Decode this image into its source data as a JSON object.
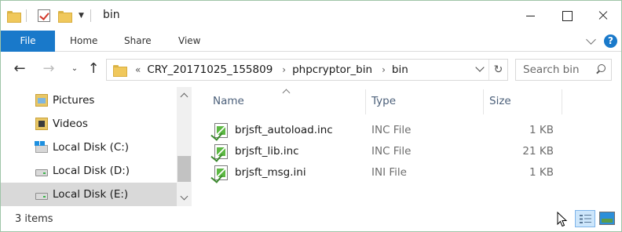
{
  "window": {
    "title": "bin",
    "accent_color": "#1979ca",
    "controls": [
      "minimize",
      "maximize",
      "close"
    ]
  },
  "ribbon": {
    "tabs": [
      {
        "label": "File",
        "active": true
      },
      {
        "label": "Home"
      },
      {
        "label": "Share"
      },
      {
        "label": "View"
      }
    ],
    "help_label": "?"
  },
  "address": {
    "overflow": "«",
    "breadcrumbs": [
      "CRY_20171025_155809",
      "phpcryptor_bin",
      "bin"
    ],
    "separator": "›"
  },
  "search": {
    "placeholder": "Search bin"
  },
  "nav_pane": {
    "items": [
      {
        "label": "Pictures",
        "icon": "pictures-folder-icon"
      },
      {
        "label": "Videos",
        "icon": "videos-folder-icon"
      },
      {
        "label": "Local Disk (C:)",
        "icon": "windows-drive-icon"
      },
      {
        "label": "Local Disk (D:)",
        "icon": "drive-icon"
      },
      {
        "label": "Local Disk (E:)",
        "icon": "drive-icon",
        "selected": true
      }
    ]
  },
  "file_list": {
    "columns": [
      "Name",
      "Type",
      "Size"
    ],
    "sort_column": "Name",
    "rows": [
      {
        "name": "brjsft_autoload.inc",
        "type": "INC File",
        "size": "1 KB"
      },
      {
        "name": "brjsft_lib.inc",
        "type": "INC File",
        "size": "21 KB"
      },
      {
        "name": "brjsft_msg.ini",
        "type": "INI File",
        "size": "1 KB"
      }
    ]
  },
  "status": {
    "item_count": "3 items",
    "active_view": "details"
  }
}
